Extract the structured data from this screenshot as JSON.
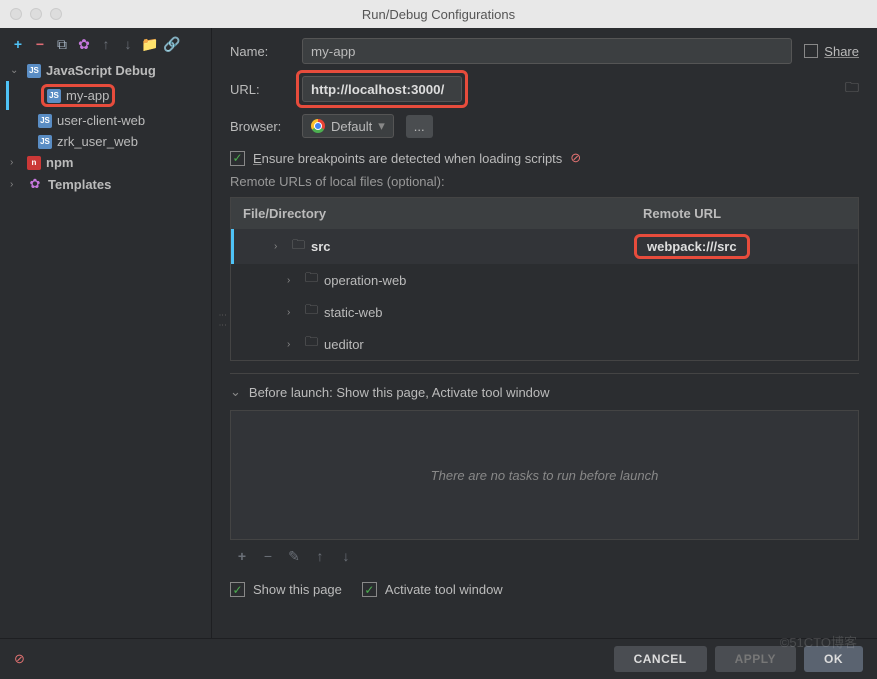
{
  "window": {
    "title": "Run/Debug Configurations"
  },
  "toolbar": {
    "plus": "+",
    "minus": "−"
  },
  "sidebar": {
    "root_label": "JavaScript Debug",
    "items": [
      {
        "label": "my-app",
        "selected": true,
        "highlighted": true
      },
      {
        "label": "user-client-web",
        "selected": false
      },
      {
        "label": "zrk_user_web",
        "selected": false
      }
    ],
    "npm_label": "npm",
    "templates_label": "Templates"
  },
  "form": {
    "name_label": "Name:",
    "name_value": "my-app",
    "share_label": "Share",
    "url_label": "URL:",
    "url_value": "http://localhost:3000/",
    "browser_label": "Browser:",
    "browser_value": "Default",
    "ellipsis": "...",
    "ensure_bp": "Ensure breakpoints are detected when loading scripts",
    "remote_label": "Remote URLs of local files (optional):",
    "table": {
      "col_file": "File/Directory",
      "col_remote": "Remote URL",
      "rows": [
        {
          "name": "src",
          "remote": "webpack:///src",
          "selected": true,
          "indent": false
        },
        {
          "name": "operation-web",
          "remote": "",
          "indent": true
        },
        {
          "name": "static-web",
          "remote": "",
          "indent": true
        },
        {
          "name": "ueditor",
          "remote": "",
          "indent": true
        }
      ]
    },
    "before_launch": "Before launch: Show this page, Activate tool window",
    "no_tasks": "There are no tasks to run before launch",
    "show_page": "Show this page",
    "activate_tw": "Activate tool window"
  },
  "buttons": {
    "cancel": "CANCEL",
    "apply": "APPLY",
    "ok": "OK"
  },
  "watermark": "©51CTO博客"
}
